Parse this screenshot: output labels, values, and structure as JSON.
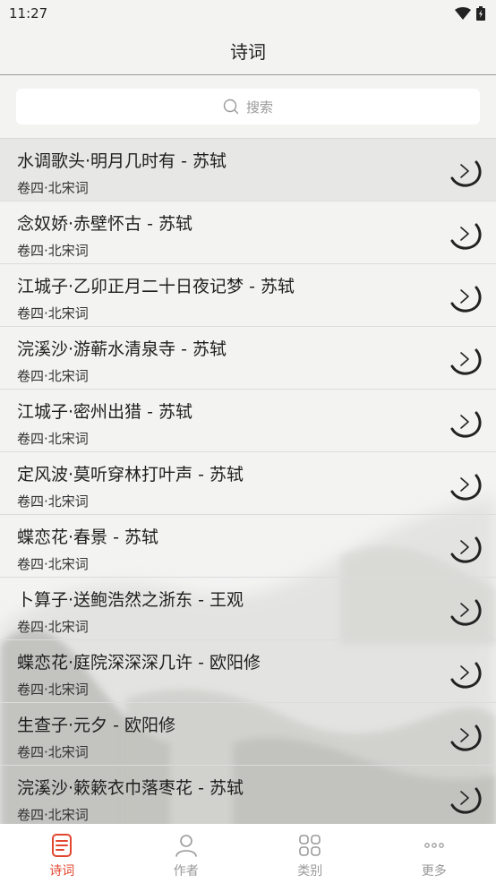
{
  "status_bar": {
    "time": "11:27"
  },
  "header": {
    "title": "诗词"
  },
  "search": {
    "placeholder": "搜索"
  },
  "poems": [
    {
      "title": "水调歌头·明月几时有 - 苏轼",
      "subtitle": "卷四·北宋词"
    },
    {
      "title": "念奴娇·赤壁怀古 - 苏轼",
      "subtitle": "卷四·北宋词"
    },
    {
      "title": "江城子·乙卯正月二十日夜记梦 - 苏轼",
      "subtitle": "卷四·北宋词"
    },
    {
      "title": "浣溪沙·游蕲水清泉寺 - 苏轼",
      "subtitle": "卷四·北宋词"
    },
    {
      "title": "江城子·密州出猎 - 苏轼",
      "subtitle": "卷四·北宋词"
    },
    {
      "title": "定风波·莫听穿林打叶声 - 苏轼",
      "subtitle": "卷四·北宋词"
    },
    {
      "title": "蝶恋花·春景 - 苏轼",
      "subtitle": "卷四·北宋词"
    },
    {
      "title": "卜算子·送鲍浩然之浙东 - 王观",
      "subtitle": "卷四·北宋词"
    },
    {
      "title": "蝶恋花·庭院深深深几许 - 欧阳修",
      "subtitle": "卷四·北宋词"
    },
    {
      "title": "生查子·元夕 - 欧阳修",
      "subtitle": "卷四·北宋词"
    },
    {
      "title": "浣溪沙·簌簌衣巾落枣花 - 苏轼",
      "subtitle": "卷四·北宋词"
    }
  ],
  "tabbar": {
    "tabs": [
      {
        "label": "诗词",
        "icon": "poem-icon",
        "active": true
      },
      {
        "label": "作者",
        "icon": "person-icon",
        "active": false
      },
      {
        "label": "类别",
        "icon": "category-icon",
        "active": false
      },
      {
        "label": "更多",
        "icon": "more-icon",
        "active": false
      }
    ]
  },
  "colors": {
    "accent": "#e2462f",
    "inactive": "#999999",
    "background": "#f3f3f2"
  }
}
